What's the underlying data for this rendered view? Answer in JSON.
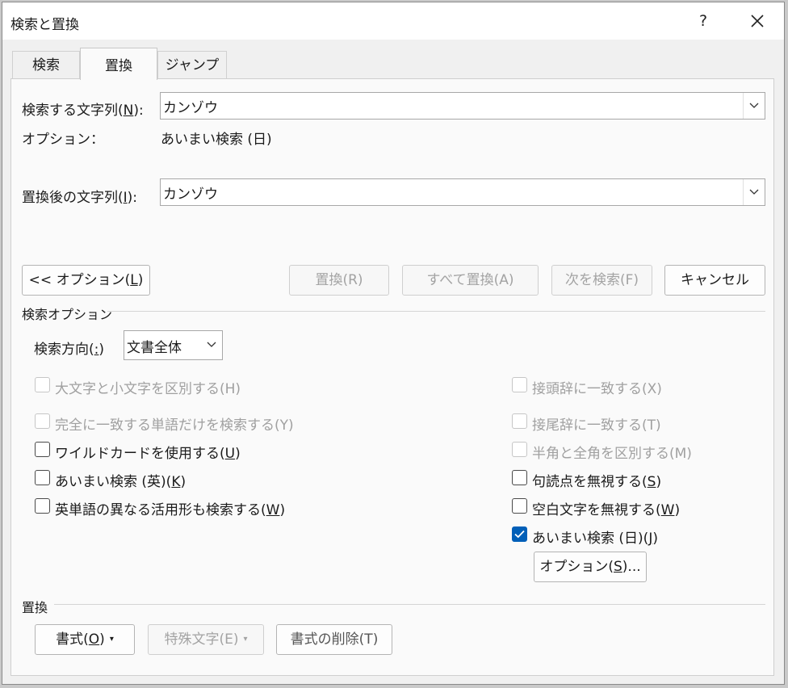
{
  "window": {
    "title": "検索と置換",
    "help": "?",
    "close_icon": "close-icon"
  },
  "tabs": [
    {
      "label": "検索",
      "active": false
    },
    {
      "label": "置換",
      "active": true
    },
    {
      "label": "ジャンプ",
      "active": false
    }
  ],
  "find": {
    "label_pre": "検索する文字列(",
    "label_key": "N",
    "label_post": "):",
    "value": "カンゾウ"
  },
  "options_row": {
    "label": "オプション：",
    "value": "あいまい検索 (日)"
  },
  "replace": {
    "label_pre": "置換後の文字列(",
    "label_key": "I",
    "label_post": "):",
    "value": "カンゾウ"
  },
  "buttons": {
    "options_toggle_pre": "<< オプション(",
    "options_toggle_key": "L",
    "options_toggle_post": ")",
    "replace": "置換(R)",
    "replace_all": "すべて置換(A)",
    "find_next": "次を検索(F)",
    "cancel": "キャンセル"
  },
  "search_options": {
    "header": "検索オプション",
    "direction_pre": "検索方向(",
    "direction_key": ":",
    "direction_post": ")",
    "direction_value": "文書全体",
    "left": [
      {
        "label": "大文字と小文字を区別する(H)",
        "checked": false,
        "disabled": true
      },
      {
        "label": "完全に一致する単語だけを検索する(Y)",
        "checked": false,
        "disabled": true
      },
      {
        "pre": "ワイルドカードを使用する(",
        "key": "U",
        "post": ")",
        "checked": false,
        "disabled": false
      },
      {
        "pre": "あいまい検索 (英)(",
        "key": "K",
        "post": ")",
        "checked": false,
        "disabled": false
      },
      {
        "pre": "英単語の異なる活用形も検索する(",
        "key": "W",
        "post": ")",
        "checked": false,
        "disabled": false
      }
    ],
    "right": [
      {
        "label": "接頭辞に一致する(X)",
        "checked": false,
        "disabled": true
      },
      {
        "label": "接尾辞に一致する(T)",
        "checked": false,
        "disabled": true
      },
      {
        "label": "半角と全角を区別する(M)",
        "checked": false,
        "disabled": true
      },
      {
        "pre": "句読点を無視する(",
        "key": "S",
        "post": ")",
        "checked": false,
        "disabled": false
      },
      {
        "pre": "空白文字を無視する(",
        "key": "W",
        "post": ")",
        "checked": false,
        "disabled": false
      },
      {
        "pre": "あいまい検索 (日)(",
        "key": "J",
        "post": ")",
        "checked": true,
        "disabled": false
      }
    ],
    "fuzzy_options_pre": "オプション(",
    "fuzzy_options_key": "S",
    "fuzzy_options_post": ")..."
  },
  "replace_section": {
    "header": "置換",
    "format_pre": "書式(",
    "format_key": "O",
    "format_post": ")",
    "special": "特殊文字(E)",
    "no_format": "書式の削除(T)"
  },
  "colors": {
    "accent": "#005fb8",
    "disabled_text": "#a0a0a0"
  }
}
